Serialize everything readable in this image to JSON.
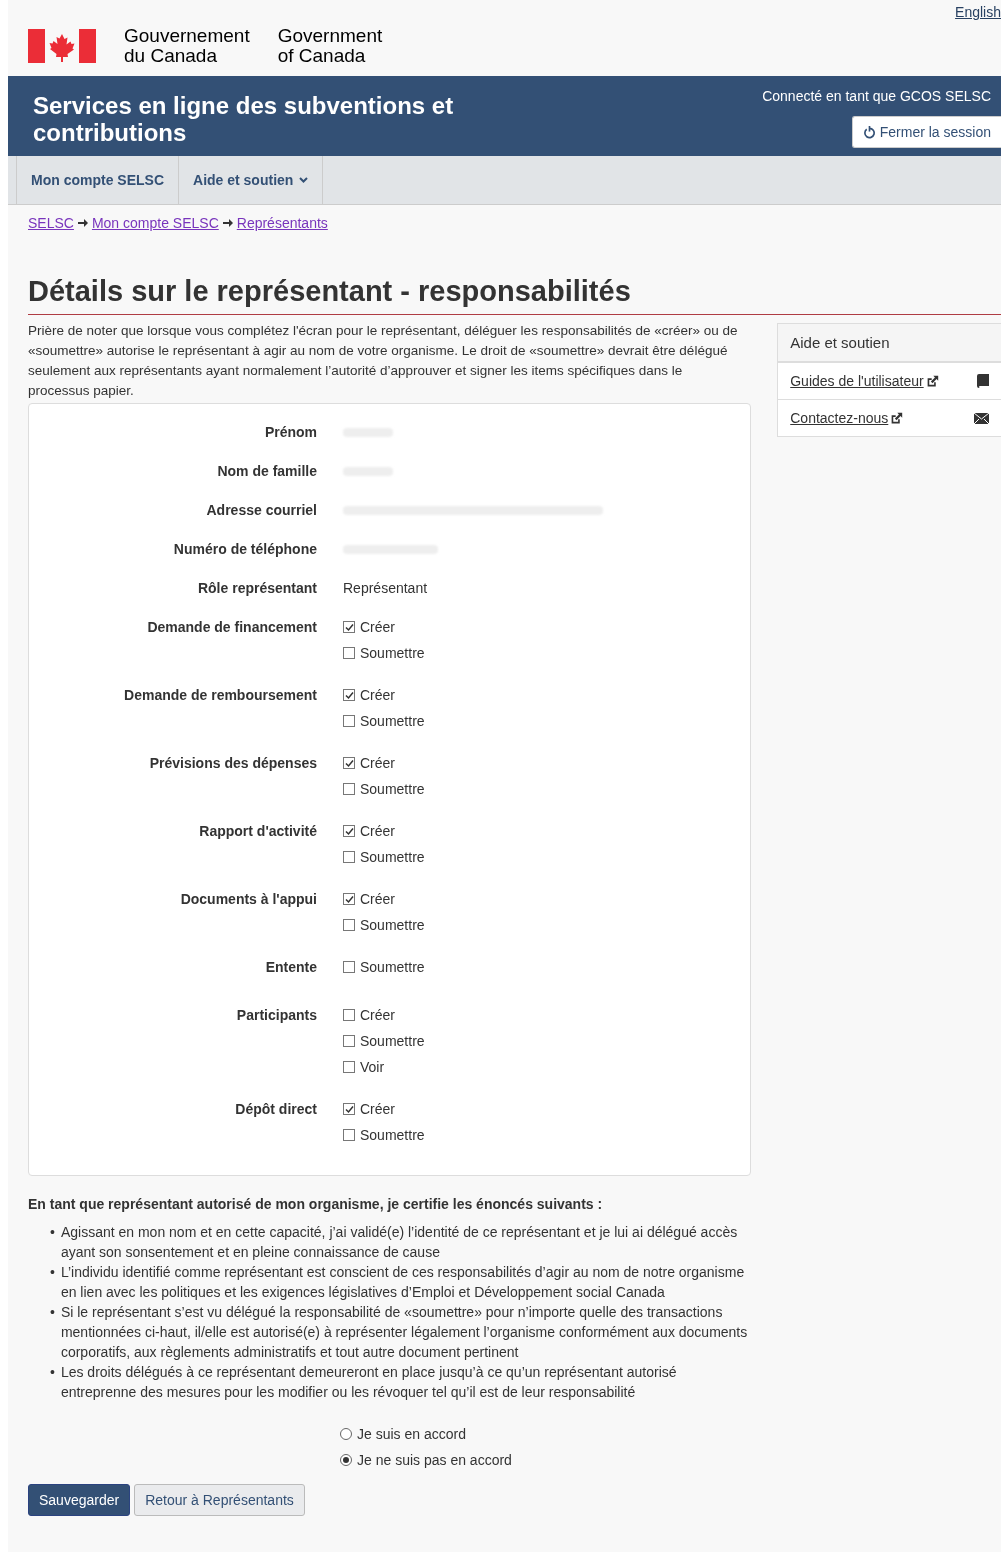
{
  "language_link": "English",
  "signature": {
    "fr": [
      "Gouvernement",
      "du Canada"
    ],
    "en": [
      "Government",
      "of Canada"
    ]
  },
  "banner": {
    "title": "Services en ligne des subventions et contributions",
    "user": "Connecté en tant que GCOS SELSC",
    "logout": "Fermer la session"
  },
  "menu": [
    {
      "label": "Mon compte SELSC",
      "dropdown": false
    },
    {
      "label": "Aide et soutien",
      "dropdown": true
    }
  ],
  "breadcrumbs": [
    "SELSC",
    "Mon compte SELSC",
    "Représentants"
  ],
  "heading": "Détails sur le représentant - responsabilités",
  "intro": "Prière de noter que lorsque vous complétez l'écran pour le représentant, déléguer les responsabilités de «créer» ou de «soumettre» autorise le représentant à agir au nom de votre organisme. Le droit de «soumettre» devrait être délégué seulement aux représentants ayant normalement l’autorité d’approuver et signer les items spécifiques dans le processus papier.",
  "fields": [
    {
      "label": "Prénom",
      "kind": "redacted"
    },
    {
      "label": "Nom de famille",
      "kind": "redacted"
    },
    {
      "label": "Adresse courriel",
      "kind": "redacted"
    },
    {
      "label": "Numéro de téléphone",
      "kind": "redacted"
    },
    {
      "label": "Rôle représentant",
      "kind": "text",
      "value": "Représentant"
    }
  ],
  "permissions": [
    {
      "label": "Demande de financement",
      "options": [
        {
          "label": "Créer",
          "checked": true
        },
        {
          "label": "Soumettre",
          "checked": false
        }
      ]
    },
    {
      "label": "Demande de remboursement",
      "options": [
        {
          "label": "Créer",
          "checked": true
        },
        {
          "label": "Soumettre",
          "checked": false
        }
      ]
    },
    {
      "label": "Prévisions des dépenses",
      "options": [
        {
          "label": "Créer",
          "checked": true
        },
        {
          "label": "Soumettre",
          "checked": false
        }
      ]
    },
    {
      "label": "Rapport d'activité",
      "options": [
        {
          "label": "Créer",
          "checked": true
        },
        {
          "label": "Soumettre",
          "checked": false
        }
      ]
    },
    {
      "label": "Documents à l'appui",
      "options": [
        {
          "label": "Créer",
          "checked": true
        },
        {
          "label": "Soumettre",
          "checked": false
        }
      ]
    },
    {
      "label": "Entente",
      "options": [
        {
          "label": "Soumettre",
          "checked": false
        }
      ]
    },
    {
      "label": "Participants",
      "options": [
        {
          "label": "Créer",
          "checked": false
        },
        {
          "label": "Soumettre",
          "checked": false
        },
        {
          "label": "Voir",
          "checked": false
        }
      ]
    },
    {
      "label": "Dépôt direct",
      "options": [
        {
          "label": "Créer",
          "checked": true
        },
        {
          "label": "Soumettre",
          "checked": false
        }
      ]
    }
  ],
  "certification": {
    "marker": "•",
    "title": "En tant que représentant autorisé de mon organisme, je certifie les énoncés suivants :",
    "items": [
      "Agissant en mon nom et en cette capacité, j’ai validé(e) l’identité de ce représentant et je lui ai délégué accès ayant son sonsentement et en pleine connaissance de cause",
      "L’individu identifié comme représentant est conscient de ces responsabilités d’agir au nom de notre organisme en lien avec les politiques et les exigences législatives d’Emploi et Développement social Canada",
      "Si le représentant s’est vu délégué la responsabilité de «soumettre» pour n’importe quelle des transactions mentionnées ci-haut, il/elle est autorisé(e) à représenter légalement l’organisme conformément aux documents corporatifs, aux règlements administratifs et tout autre document pertinent",
      "Les droits délégués à ce représentant demeureront en place jusqu’à ce qu’un représentant autorisé entreprenne des mesures pour les modifier ou les révoquer tel qu’il est de leur responsabilité"
    ],
    "choices": [
      {
        "label": "Je suis en accord",
        "selected": false
      },
      {
        "label": "Je ne suis pas en accord",
        "selected": true
      }
    ]
  },
  "buttons": [
    {
      "label": "Sauvegarder",
      "kind": "primary"
    },
    {
      "label": "Retour à Représentants",
      "kind": "default"
    }
  ],
  "sidebar": {
    "title": "Aide et soutien",
    "links": [
      {
        "label": "Guides de l'utilisateur",
        "kind": "book"
      },
      {
        "label": "Contactez-nous",
        "kind": "mail"
      }
    ]
  }
}
